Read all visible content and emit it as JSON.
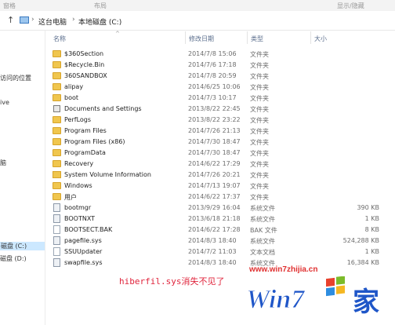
{
  "ribbon": {
    "left": "窗格",
    "middle": "布局",
    "right": "显示/隐藏"
  },
  "address": {
    "crumbs": [
      "这台电脑",
      "本地磁盘 (C:)"
    ]
  },
  "nav": {
    "items": [
      {
        "label": "访问的位置"
      },
      {
        "label": "ive"
      },
      {
        "label": "脑"
      },
      {
        "label": "磁盘 (C:)",
        "selected": true
      },
      {
        "label": "磁盘 (D:)"
      }
    ]
  },
  "columns": {
    "name": "名称",
    "date": "修改日期",
    "type": "类型",
    "size": "大小"
  },
  "files": [
    {
      "name": "$360Section",
      "date": "2014/7/8 15:06",
      "type": "文件夹",
      "size": "",
      "icon": "folder"
    },
    {
      "name": "$Recycle.Bin",
      "date": "2014/7/6 17:18",
      "type": "文件夹",
      "size": "",
      "icon": "folder"
    },
    {
      "name": "360SANDBOX",
      "date": "2014/7/8 20:59",
      "type": "文件夹",
      "size": "",
      "icon": "folder"
    },
    {
      "name": "alipay",
      "date": "2014/6/25 10:06",
      "type": "文件夹",
      "size": "",
      "icon": "folder"
    },
    {
      "name": "boot",
      "date": "2014/7/3 10:17",
      "type": "文件夹",
      "size": "",
      "icon": "folder"
    },
    {
      "name": "Documents and Settings",
      "date": "2013/8/22 22:45",
      "type": "文件夹",
      "size": "",
      "icon": "shortcut"
    },
    {
      "name": "PerfLogs",
      "date": "2013/8/22 23:22",
      "type": "文件夹",
      "size": "",
      "icon": "folder"
    },
    {
      "name": "Program Files",
      "date": "2014/7/26 21:13",
      "type": "文件夹",
      "size": "",
      "icon": "folder"
    },
    {
      "name": "Program Files (x86)",
      "date": "2014/7/30 18:47",
      "type": "文件夹",
      "size": "",
      "icon": "folder"
    },
    {
      "name": "ProgramData",
      "date": "2014/7/30 18:47",
      "type": "文件夹",
      "size": "",
      "icon": "folder"
    },
    {
      "name": "Recovery",
      "date": "2014/6/22 17:29",
      "type": "文件夹",
      "size": "",
      "icon": "folder"
    },
    {
      "name": "System Volume Information",
      "date": "2014/7/26 20:21",
      "type": "文件夹",
      "size": "",
      "icon": "lock"
    },
    {
      "name": "Windows",
      "date": "2014/7/13 19:07",
      "type": "文件夹",
      "size": "",
      "icon": "folder"
    },
    {
      "name": "用户",
      "date": "2014/6/22 17:37",
      "type": "文件夹",
      "size": "",
      "icon": "folder"
    },
    {
      "name": "bootmgr",
      "date": "2013/9/29 16:04",
      "type": "系统文件",
      "size": "390 KB",
      "icon": "sysfile"
    },
    {
      "name": "BOOTNXT",
      "date": "2013/6/18 21:18",
      "type": "系统文件",
      "size": "1 KB",
      "icon": "sysfile"
    },
    {
      "name": "BOOTSECT.BAK",
      "date": "2014/6/22 17:28",
      "type": "BAK 文件",
      "size": "8 KB",
      "icon": "file"
    },
    {
      "name": "pagefile.sys",
      "date": "2014/8/3 18:40",
      "type": "系统文件",
      "size": "524,288 KB",
      "icon": "sysfile"
    },
    {
      "name": "SSUUpdater",
      "date": "2014/7/2 11:03",
      "type": "文本文档",
      "size": "1 KB",
      "icon": "file"
    },
    {
      "name": "swapfile.sys",
      "date": "2014/8/3 18:40",
      "type": "系统文件",
      "size": "16,384 KB",
      "icon": "sysfile"
    }
  ],
  "note": "hiberfil.sys消失不见了",
  "watermark": {
    "url": "www.win7zhijia.cn",
    "logo_text": "Win7",
    "logo_cn": "家"
  }
}
